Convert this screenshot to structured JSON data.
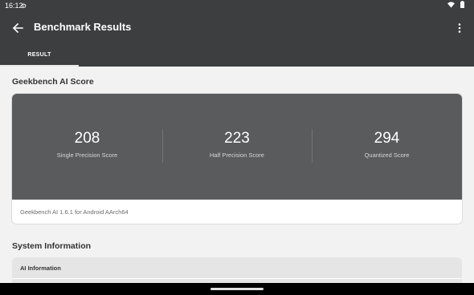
{
  "status_bar": {
    "time": "16:12",
    "icons": [
      "settings-gear-icon",
      "wifi-icon",
      "battery-icon"
    ]
  },
  "app_bar": {
    "title": "Benchmark Results",
    "back_icon": "arrow-left-icon",
    "menu_icon": "more-vert-icon",
    "tabs": [
      {
        "label": "RESULT",
        "selected": true
      }
    ]
  },
  "ai_score": {
    "heading": "Geekbench AI Score",
    "scores": [
      {
        "value": "208",
        "label": "Single Precision Score"
      },
      {
        "value": "223",
        "label": "Half Precision Score"
      },
      {
        "value": "294",
        "label": "Quantized Score"
      }
    ],
    "footer": "Geekbench AI 1.6.1 for Android AArch64"
  },
  "system_info": {
    "heading": "System Information",
    "section_header": "AI Information"
  },
  "colors": {
    "app_bar": "#3d3e40",
    "score_panel": "#5a5b5d",
    "background": "#f2f2f2"
  }
}
